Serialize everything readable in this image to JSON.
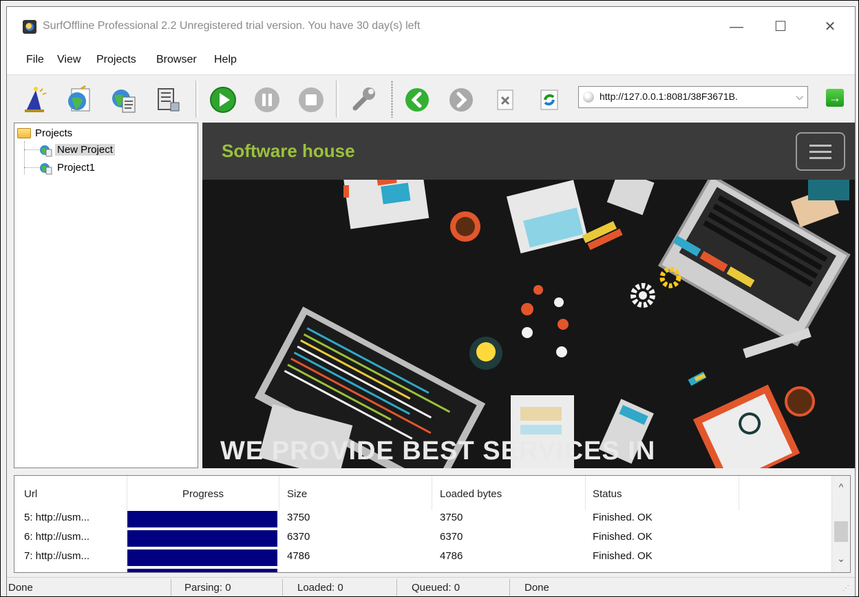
{
  "window": {
    "title": "SurfOffline Professional 2.2  Unregistered trial version. You have 30 day(s) left",
    "minimize_glyph": "—",
    "maximize_glyph": "☐",
    "close_glyph": "✕"
  },
  "menu": [
    "File",
    "View",
    "Projects",
    "Browser",
    "Help"
  ],
  "toolbar": {
    "address": "http://127.0.0.1:8081/38F3671B.",
    "dropdown_glyph": "⌵",
    "go_glyph": "→",
    "icons": [
      "wizard-icon",
      "new-project-icon",
      "project-properties-icon",
      "export-icon",
      "start-icon",
      "pause-icon",
      "stop-icon",
      "options-icon",
      "back-icon",
      "forward-icon",
      "stop-page-icon",
      "refresh-icon"
    ]
  },
  "tree": {
    "root": "Projects",
    "items": [
      "New Project",
      "Project1"
    ],
    "selected": "New Project"
  },
  "browser": {
    "brand": "Software house",
    "hero_text": "WE PROVIDE BEST SERVICES IN"
  },
  "list": {
    "columns": [
      "Url",
      "Progress",
      "Size",
      "Loaded bytes",
      "Status"
    ],
    "rows": [
      {
        "url": "5: http://usm...",
        "progress": 1.0,
        "size": "3750",
        "loaded": "3750",
        "status": "Finished. OK"
      },
      {
        "url": "6: http://usm...",
        "progress": 1.0,
        "size": "6370",
        "loaded": "6370",
        "status": "Finished. OK"
      },
      {
        "url": "7: http://usm...",
        "progress": 1.0,
        "size": "4786",
        "loaded": "4786",
        "status": "Finished. OK"
      }
    ],
    "scroll_up_glyph": "^",
    "scroll_down_glyph": "⌄"
  },
  "status": {
    "left": "Done",
    "parsing": "Parsing: 0",
    "loaded": "Loaded: 0",
    "queued": "Queued: 0",
    "right": "Done"
  },
  "colors": {
    "brand_green": "#9bc13c",
    "progress_fill": "#000080",
    "header_bg": "#3b3b3b"
  }
}
